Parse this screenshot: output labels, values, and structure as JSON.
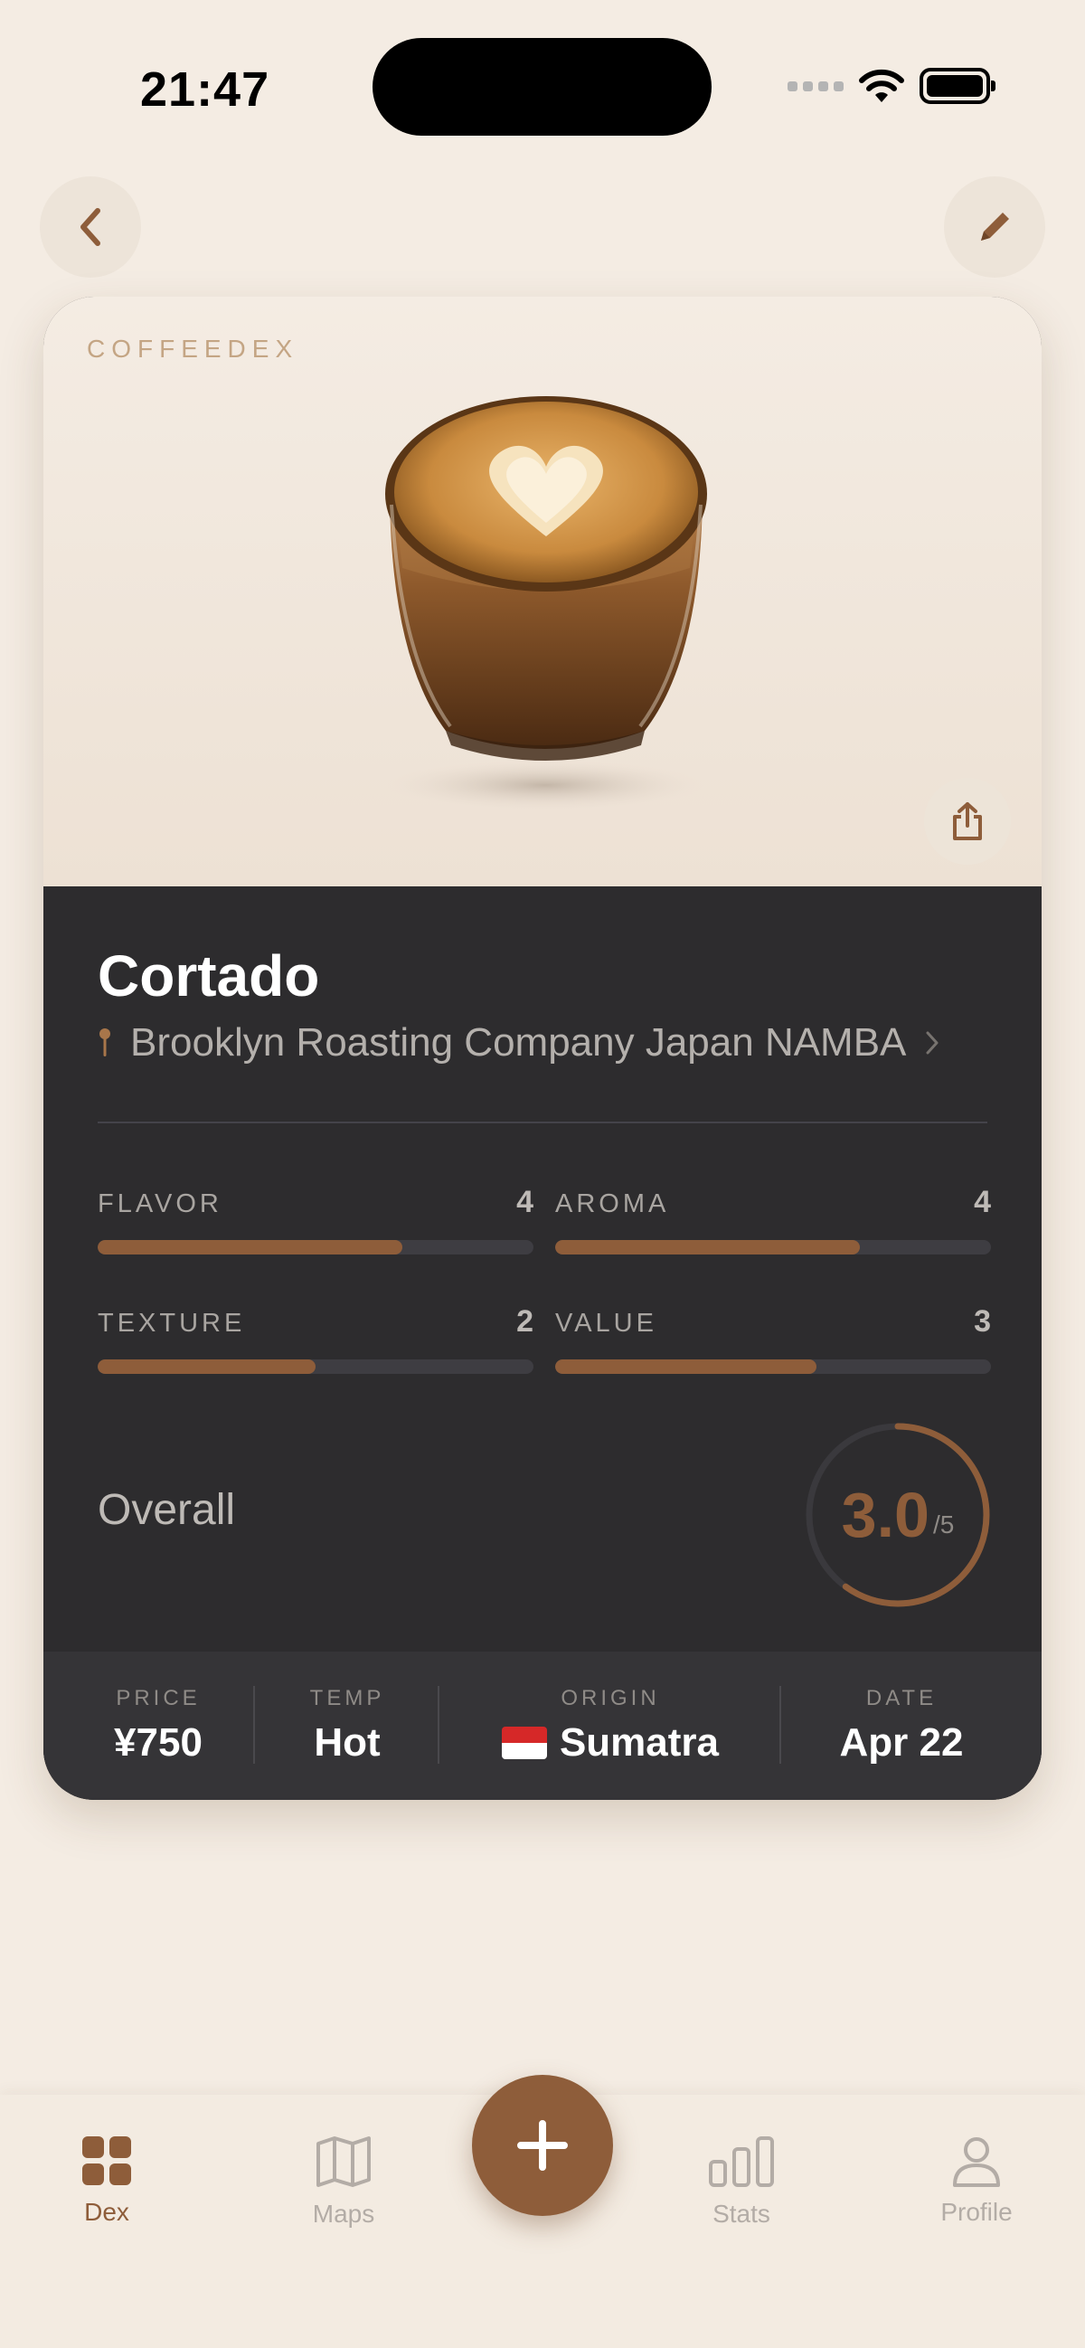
{
  "status_bar": {
    "time": "21:47"
  },
  "card": {
    "brand": "COFFEEDEX",
    "drink_name": "Cortado",
    "location": "Brooklyn Roasting Company Japan NAMBA",
    "ratings": [
      {
        "label": "FLAVOR",
        "value": "4",
        "fill": 0.7
      },
      {
        "label": "AROMA",
        "value": "4",
        "fill": 0.7
      },
      {
        "label": "TEXTURE",
        "value": "2",
        "fill": 0.5
      },
      {
        "label": "VALUE",
        "value": "3",
        "fill": 0.6
      }
    ],
    "overall": {
      "label": "Overall",
      "score": "3.0",
      "max": "/5",
      "fraction": 0.6
    },
    "info": {
      "price": {
        "label": "PRICE",
        "value": "¥750"
      },
      "temp": {
        "label": "TEMP",
        "value": "Hot"
      },
      "origin": {
        "label": "ORIGIN",
        "value": "Sumatra",
        "flag": "indonesia-flag"
      },
      "date": {
        "label": "DATE",
        "value": "Apr 22"
      }
    }
  },
  "tabs": [
    {
      "label": "Dex",
      "icon": "grid-icon",
      "active": true
    },
    {
      "label": "Maps",
      "icon": "map-icon",
      "active": false
    },
    {
      "label": "Stats",
      "icon": "bar-chart-icon",
      "active": false
    },
    {
      "label": "Profile",
      "icon": "person-icon",
      "active": false
    }
  ],
  "colors": {
    "accent": "#8E5D3A",
    "background": "#F4ECE3",
    "card_dark": "#2D2C2E"
  }
}
